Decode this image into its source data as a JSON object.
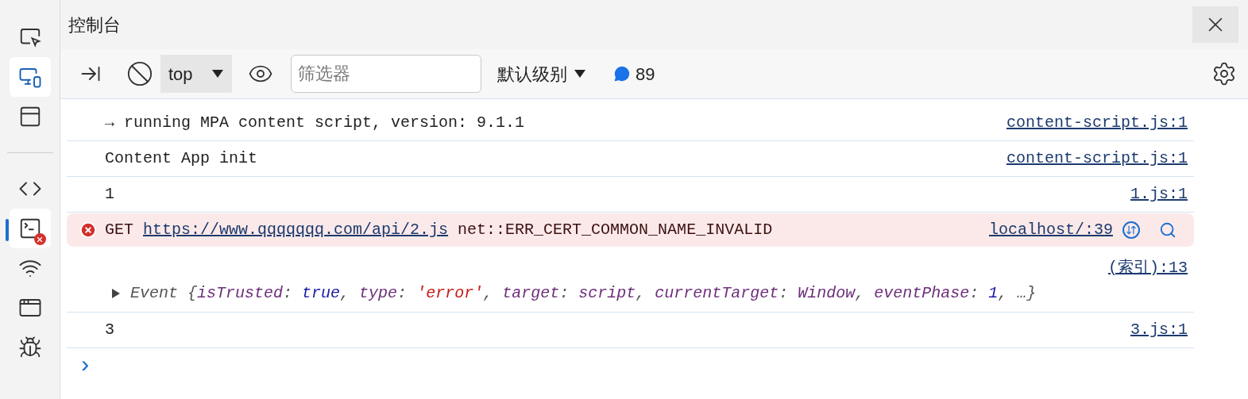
{
  "sidebar": {
    "items": [
      {
        "kind": "inspect",
        "selected": false,
        "has_error": false
      },
      {
        "kind": "device",
        "selected": true,
        "has_error": false
      },
      {
        "kind": "window",
        "selected": false,
        "has_error": false
      },
      {
        "kind": "divider"
      },
      {
        "kind": "elements",
        "selected": false,
        "has_error": false
      },
      {
        "kind": "console",
        "selected": true,
        "has_error": true
      },
      {
        "kind": "network",
        "selected": false,
        "has_error": false
      },
      {
        "kind": "application",
        "selected": false,
        "has_error": false
      },
      {
        "kind": "debug",
        "selected": false,
        "has_error": false
      }
    ]
  },
  "panel": {
    "title": "控制台"
  },
  "toolbar": {
    "context": "top",
    "filter": {
      "placeholder": "筛选器"
    },
    "level": "默认级别",
    "message_count": "89"
  },
  "messages": [
    {
      "kind": "log",
      "text": "→ running MPA content script, version: 9.1.1",
      "source": "content-script.js:1"
    },
    {
      "kind": "log",
      "text": "Content App init",
      "source": "content-script.js:1"
    },
    {
      "kind": "log",
      "text": "1",
      "source": "1.js:1"
    },
    {
      "kind": "error",
      "method": "GET",
      "url": "https://www.qqqqqqq.com/api/2.js",
      "text": "net::ERR_CERT_COMMON_NAME_INVALID",
      "source": "localhost/:39"
    },
    {
      "kind": "object",
      "source": "(索引):13",
      "expanded": false,
      "tokens": [
        {
          "kind": "plain",
          "s": "Event {"
        },
        {
          "kind": "key",
          "s": "isTrusted"
        },
        {
          "kind": "plain",
          "s": ": "
        },
        {
          "kind": "bool",
          "s": "true"
        },
        {
          "kind": "plain",
          "s": ", "
        },
        {
          "kind": "key",
          "s": "type"
        },
        {
          "kind": "plain",
          "s": ": "
        },
        {
          "kind": "string",
          "s": "'error'"
        },
        {
          "kind": "plain",
          "s": ", "
        },
        {
          "kind": "key",
          "s": "target"
        },
        {
          "kind": "plain",
          "s": ": "
        },
        {
          "kind": "name",
          "s": "script"
        },
        {
          "kind": "plain",
          "s": ", "
        },
        {
          "kind": "key",
          "s": "currentTarget"
        },
        {
          "kind": "plain",
          "s": ": "
        },
        {
          "kind": "name",
          "s": "Window"
        },
        {
          "kind": "plain",
          "s": ", "
        },
        {
          "kind": "key",
          "s": "eventPhase"
        },
        {
          "kind": "plain",
          "s": ": "
        },
        {
          "kind": "bool",
          "s": "1"
        },
        {
          "kind": "plain",
          "s": ", …}"
        }
      ]
    },
    {
      "kind": "log",
      "text": "3",
      "source": "3.js:1"
    }
  ],
  "prompt": "›"
}
